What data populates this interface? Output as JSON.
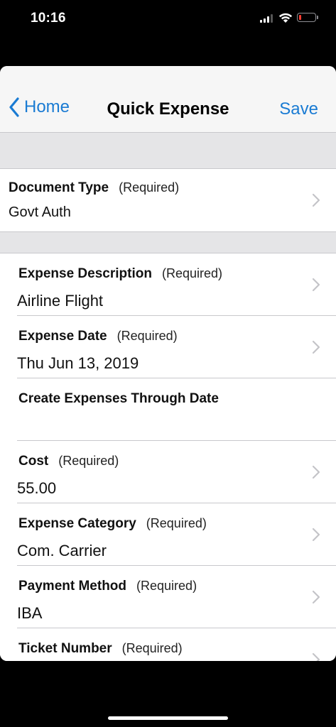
{
  "status_bar": {
    "time": "10:16"
  },
  "navbar": {
    "back_label": "Home",
    "title": "Quick Expense",
    "save_label": "Save"
  },
  "document_type": {
    "label": "Document Type",
    "required": "(Required)",
    "value": "Govt Auth"
  },
  "fields": [
    {
      "label": "Expense Description",
      "required": "(Required)",
      "value": "Airline Flight",
      "has_chevron": true
    },
    {
      "label": "Expense Date",
      "required": "(Required)",
      "value": "Thu Jun 13, 2019",
      "has_chevron": true
    },
    {
      "label": "Create Expenses Through Date",
      "required": "",
      "value": "",
      "has_chevron": false
    },
    {
      "label": "Cost",
      "required": "(Required)",
      "value": "55.00",
      "has_chevron": true
    },
    {
      "label": "Expense Category",
      "required": "(Required)",
      "value": "Com. Carrier",
      "has_chevron": true
    },
    {
      "label": "Payment Method",
      "required": "(Required)",
      "value": "IBA",
      "has_chevron": true
    },
    {
      "label": "Ticket Number",
      "required": "(Required)",
      "value": "",
      "has_chevron": true
    }
  ],
  "colors": {
    "accent": "#1a7bd3",
    "battery_low": "#ff3b30",
    "section_gap": "#e5e5e7"
  },
  "icons": {
    "back": "chevron-left-icon",
    "row": "chevron-right-icon",
    "signal": "cellular-signal-icon",
    "wifi": "wifi-icon",
    "battery": "battery-icon"
  }
}
